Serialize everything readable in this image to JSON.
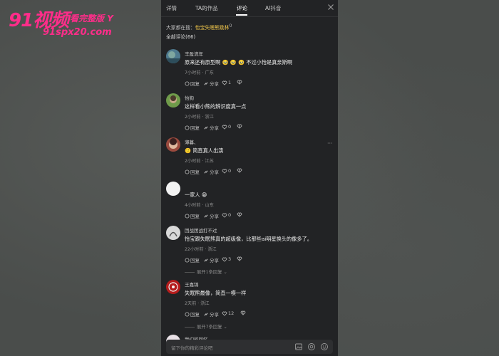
{
  "watermark": {
    "brand": "91视频",
    "tag": "看完整版 Y",
    "url": "91spx20.com"
  },
  "tabs": [
    "详情",
    "TA的作品",
    "评论",
    "AI抖音"
  ],
  "active_tab": "评论",
  "search": {
    "prefix": "大家都在搜：",
    "keyword": "怡宝失眠熊跳林",
    "sup": "Q"
  },
  "all_comments": "全部评论(66)",
  "comments": [
    {
      "user": "丰盈流年",
      "text": "原来还有原型啊 🥹 🥹 🥹 不过小怡是真亲斯啊",
      "meta": "7小时前 · 广东",
      "reply": "回复",
      "share": "分享",
      "likes": "1",
      "avatar_color": "#4f7a8f"
    },
    {
      "user": "怡狗",
      "text": "这样看小熊的辨识度真一点",
      "meta": "2小时前 · 浙江",
      "reply": "回复",
      "share": "分享",
      "likes": "0",
      "avatar_color": "#6f9b4a"
    },
    {
      "user": "薄暮、",
      "text": "🙂 简直真人出演",
      "meta": "2小时前 · 江苏",
      "reply": "回复",
      "share": "分享",
      "likes": "0",
      "avatar_color": "#9a4a3e",
      "more": "···"
    },
    {
      "user": "一家人 😁",
      "text": "",
      "meta": "4小时前 · 山东",
      "reply": "回复",
      "share": "分享",
      "likes": "0",
      "avatar_color": "#f2f2f2"
    },
    {
      "user": "团战团战打不过",
      "text": "怡宝跟失眠熊真的超级像，比那些ai明星换头的像多了。",
      "meta": "22小时前 · 浙江",
      "reply": "回复",
      "share": "分享",
      "likes": "3",
      "avatar_color": "#d9d9d9",
      "expand": "展开1条回复"
    },
    {
      "user": "王嘉锦",
      "text": "失眠熊最像，简直一模一样",
      "meta": "2天前 · 浙江",
      "reply": "回复",
      "share": "分享",
      "likes": "12",
      "avatar_color": "#b51c1c",
      "expand": "展开7条回复"
    }
  ],
  "partial_user": "我们的回忆",
  "input": {
    "placeholder": "留下你的精彩评论吧"
  },
  "colors": {
    "panel": "#222325",
    "accent_keyword": "#f2c84b",
    "watermark": "#ff2d8a"
  }
}
